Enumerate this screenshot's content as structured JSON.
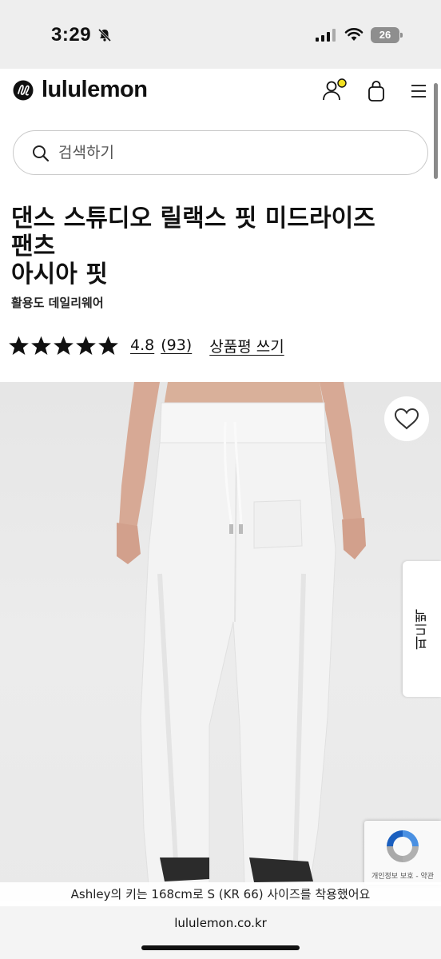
{
  "status_bar": {
    "time": "3:29",
    "battery": "26"
  },
  "header": {
    "brand": "lululemon"
  },
  "search": {
    "placeholder": "검색하기"
  },
  "product": {
    "title_line1": "댄스 스튜디오 릴랙스 핏 미드라이즈",
    "title_line2": "팬츠",
    "title_line3": "아시아 핏",
    "subtitle": "활용도 데일리웨어",
    "rating_score": "4.8",
    "review_count": "(93)",
    "rating_stars": 5,
    "write_review": "상품평 쓰기"
  },
  "side": {
    "feedback": "피드백"
  },
  "recaptcha": {
    "text": "개인정보 보호 - 약관"
  },
  "caption": {
    "model_info": "Ashley의 키는 168cm로 S (KR 66) 사이즈를 착용했어요"
  },
  "browser": {
    "url": "lululemon.co.kr"
  }
}
